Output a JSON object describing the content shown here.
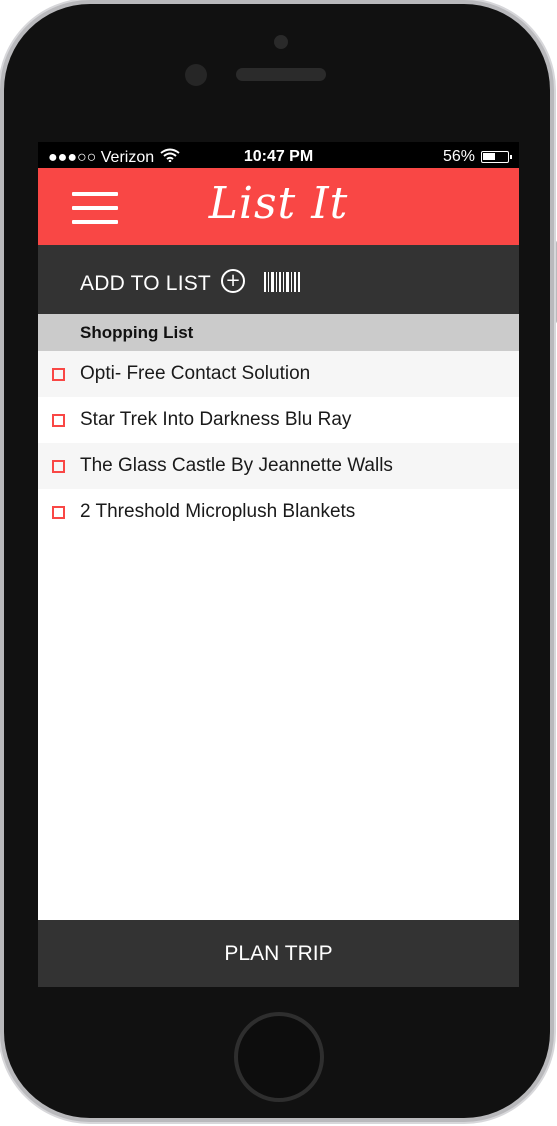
{
  "status_bar": {
    "carrier": "●●●○○ Verizon",
    "time": "10:47 PM",
    "battery_text": "56%",
    "battery_level": 0.56
  },
  "header": {
    "logo_text": "List It",
    "accent_color": "#f94745"
  },
  "add_bar": {
    "label": "ADD TO LIST",
    "add_icon": "plus-circle-icon",
    "scan_icon": "barcode-icon"
  },
  "list": {
    "title": "Shopping List",
    "items": [
      {
        "label": "Opti- Free Contact Solution",
        "checked": false
      },
      {
        "label": "Star Trek Into Darkness Blu Ray",
        "checked": false
      },
      {
        "label": "The Glass Castle By Jeannette Walls",
        "checked": false
      },
      {
        "label": "2 Threshold Microplush Blankets",
        "checked": false
      }
    ]
  },
  "footer": {
    "plan_label": "PLAN TRIP"
  }
}
